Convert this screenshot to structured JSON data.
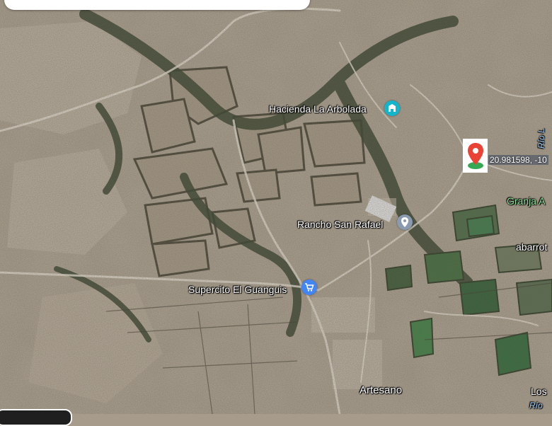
{
  "map": {
    "labels": {
      "hacienda": "Hacienda La Arbolada",
      "rancho": "Rancho San Rafael",
      "supercito": "Supercito El Guanguis",
      "artesano": "Artesano",
      "granja": "Granja A",
      "abarrot": "abarrot",
      "los": "Los",
      "rio_bottom": "Río",
      "rio_right": "Río L"
    },
    "coordinates": "20.981598, -10",
    "icons": {
      "hacienda": "hotel-icon",
      "rancho": "place-pin-icon",
      "supercito": "shopping-cart-icon",
      "marker": "location-marker-icon"
    },
    "colors": {
      "marker_red": "#ea4335",
      "marker_green": "#34a853",
      "poi_teal": "#12b5cb",
      "poi_blue": "#4285f4",
      "poi_gray": "#8a9bb0"
    }
  }
}
